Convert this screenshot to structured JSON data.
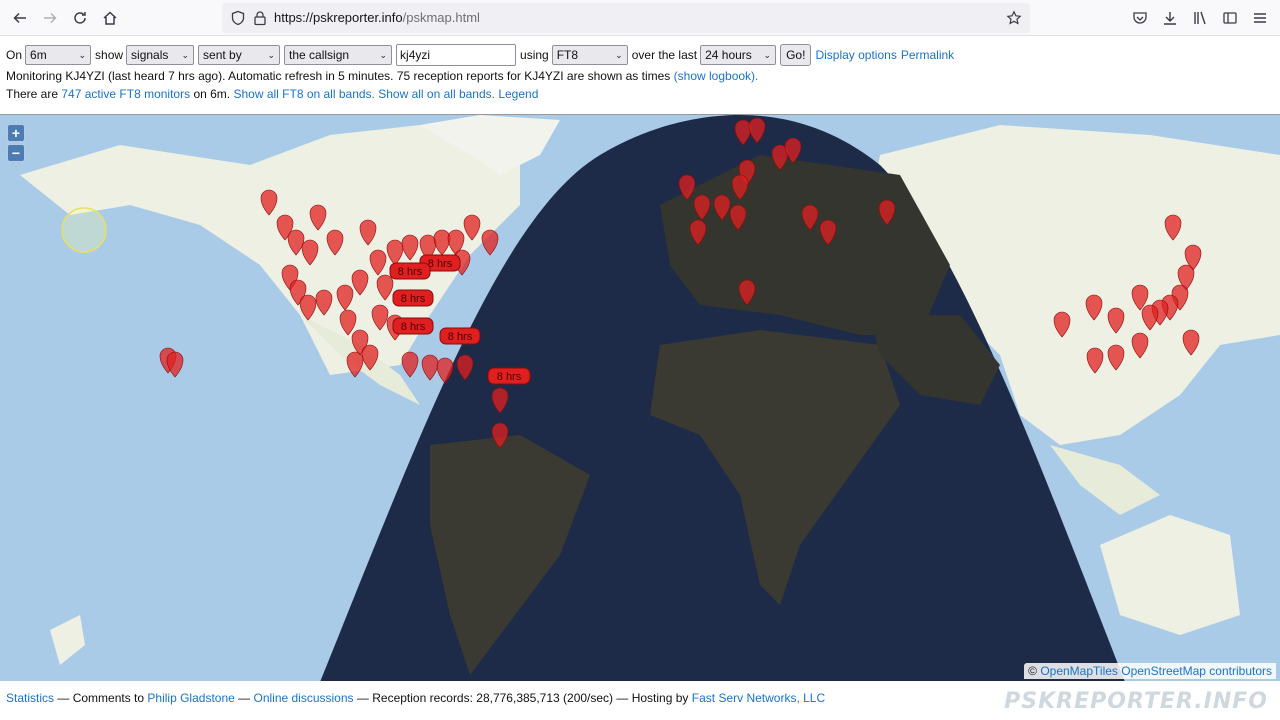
{
  "browser": {
    "url_host": "https://pskreporter.info",
    "url_path": "/pskmap.html"
  },
  "controls": {
    "on_label": "On",
    "band": "6m",
    "show_label": "show",
    "show_value": "signals",
    "direction": "sent by",
    "target": "the callsign",
    "callsign_value": "kj4yzi",
    "using_label": "using",
    "mode": "FT8",
    "over_label": "over the last",
    "period": "24 hours",
    "go_label": "Go!",
    "display_options": "Display options",
    "permalink": "Permalink"
  },
  "status": {
    "monitoring": "Monitoring KJ4YZI (last heard 7 hrs ago). Automatic refresh in 5 minutes. 75 reception reports for KJ4YZI are shown as times",
    "show_logbook": "(show logbook).",
    "there_are": "There are",
    "active_monitors": "747 active FT8 monitors",
    "on_band": "on 6m.",
    "show_all_ft8": "Show all FT8 on all bands.",
    "show_all": "Show all on all bands.",
    "legend": "Legend"
  },
  "map": {
    "zoom_in": "+",
    "zoom_out": "−",
    "time_label": "8 hrs",
    "attrib_prefix": "©",
    "attrib_tiles": "OpenMapTiles",
    "attrib_osm": "OpenStreetMap contributors",
    "colors": {
      "ocean": "#aacbe8",
      "land": "#eef0e4",
      "night": "#1e2b48",
      "marker": "#e02020"
    }
  },
  "footer": {
    "statistics": "Statistics",
    "comments_to": "— Comments to",
    "author": "Philip Gladstone",
    "sep1": "—",
    "online_discussions": "Online discussions",
    "reception": "— Reception records: 28,776,385,713 (200/sec) — Hosting by",
    "host": "Fast Serv Networks, LLC",
    "watermark": "PSKREPORTER.INFO"
  }
}
